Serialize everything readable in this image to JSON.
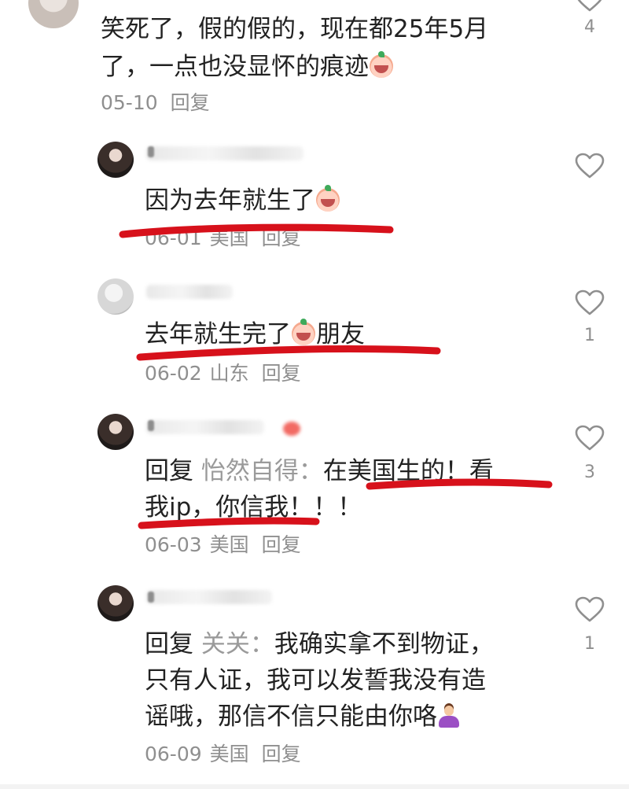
{
  "comments": [
    {
      "text_lines": [
        "笑死了，假的假的，现在都25年5月",
        "了，一点也没显怀的痕迹"
      ],
      "date": "05-10",
      "location": "",
      "reply_label": "回复",
      "likes": "4"
    },
    {
      "text": "因为去年就生了",
      "date": "06-01",
      "location": "美国",
      "reply_label": "回复",
      "likes": ""
    },
    {
      "text_a": "去年就生完了",
      "text_b": "朋友",
      "date": "06-02",
      "location": "山东",
      "reply_label": "回复",
      "likes": "1"
    },
    {
      "reply_prefix": "回复",
      "reply_to": "怡然自得：",
      "line1_rest": "在美国生的！看",
      "line2": "我ip，你信我！！！",
      "date": "06-03",
      "location": "美国",
      "reply_label": "回复",
      "likes": "3"
    },
    {
      "reply_prefix": "回复",
      "reply_to": "关关：",
      "line1_rest": "我确实拿不到物证，",
      "line2": "只有人证，我可以发誓我没有造",
      "line3": "谣哦，那信不信只能由你咯",
      "date": "06-09",
      "location": "美国",
      "reply_label": "回复",
      "likes": "1"
    }
  ],
  "colors": {
    "underline": "#d7111b",
    "text": "#222222",
    "meta": "#8f8f8f"
  },
  "icons": [
    "heart-outline-icon",
    "laugh-cry-emoji-icon",
    "shrug-emoji-icon"
  ]
}
